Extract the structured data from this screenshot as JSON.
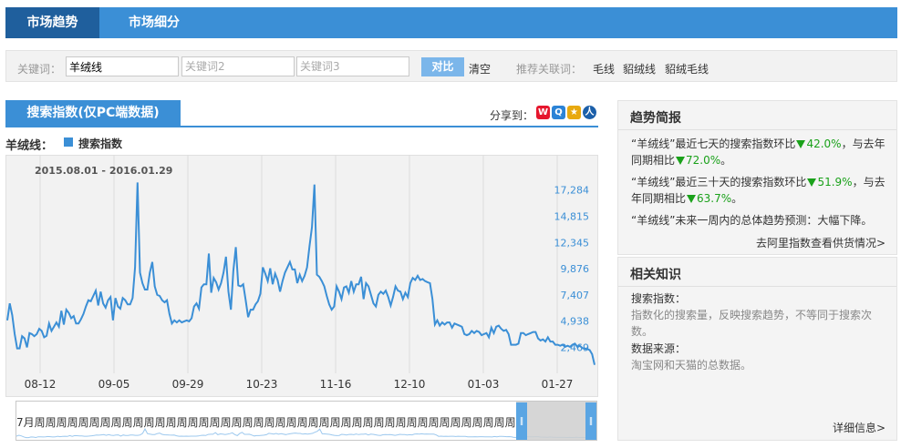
{
  "nav": {
    "tabs": [
      "市场趋势",
      "市场细分"
    ]
  },
  "keywords": {
    "label": "关键词：",
    "kw1_value": "羊绒线",
    "kw2_placeholder": "关键词2",
    "kw3_placeholder": "关键词3",
    "compare_label": "对比",
    "clear_label": "清空",
    "recommend_label": "推荐关联词：",
    "recommend": [
      "毛线",
      "貂绒线",
      "貂绒毛线"
    ]
  },
  "section": {
    "tab_label": "搜索指数(仅PC端数据)",
    "share_label": "分享到：",
    "share_icons": [
      "weibo-icon",
      "qzone-icon",
      "tencent-weibo-icon",
      "renren-icon"
    ]
  },
  "chart_head": {
    "keyword": "羊绒线：",
    "legend": "搜索指数"
  },
  "chart_data": {
    "type": "line",
    "title": "",
    "date_range": "2015.08.01 - 2016.01.29",
    "x_ticks": [
      "08-12",
      "09-05",
      "09-29",
      "10-23",
      "11-16",
      "12-10",
      "01-03",
      "01-27"
    ],
    "y_ticks": [
      2469,
      4938,
      7407,
      9876,
      12345,
      14815,
      17284
    ],
    "y_tick_labels": [
      "2,469",
      "4,938",
      "7,407",
      "9,876",
      "12,345",
      "14,815",
      "17,284"
    ],
    "ylim": [
      0,
      19753
    ],
    "grid": "vertical",
    "series": [
      {
        "name": "搜索指数",
        "color": "#3b8fd6",
        "values": [
          5000,
          6600,
          5500,
          3700,
          2350,
          2350,
          3500,
          3300,
          2450,
          3800,
          3700,
          3500,
          3700,
          4200,
          4000,
          3400,
          3550,
          4700,
          4000,
          4400,
          4800,
          4400,
          5900,
          4600,
          6000,
          5700,
          5200,
          5400,
          4700,
          4700,
          5100,
          5600,
          6300,
          6900,
          6800,
          7300,
          7800,
          6400,
          7700,
          6600,
          6200,
          6900,
          7200,
          5000,
          7100,
          6300,
          6100,
          7100,
          6900,
          6500,
          6500,
          7100,
          10000,
          18000,
          9500,
          8500,
          7900,
          7900,
          9500,
          10500,
          8200,
          7400,
          7300,
          6900,
          6700,
          6900,
          5600,
          4700,
          5000,
          4800,
          5000,
          4800,
          4900,
          5000,
          4900,
          5200,
          6300,
          6600,
          6100,
          8100,
          8400,
          8400,
          11300,
          7600,
          9000,
          8600,
          7900,
          8500,
          9500,
          11000,
          7700,
          6000,
          9700,
          11900,
          8300,
          8200,
          8400,
          6900,
          5300,
          6000,
          6000,
          6500,
          6800,
          7500,
          10000,
          9400,
          8700,
          9900,
          8400,
          9400,
          8800,
          7700,
          8700,
          9500,
          10000,
          10500,
          9800,
          9800,
          8500,
          9300,
          8700,
          9200,
          10000,
          12000,
          13800,
          17800,
          9300,
          9100,
          8700,
          8200,
          7300,
          6500,
          6000,
          6300,
          8200,
          7700,
          7000,
          8100,
          8200,
          7600,
          8700,
          7700,
          8400,
          8400,
          9100,
          7000,
          8500,
          8200,
          7400,
          6600,
          6300,
          7400,
          7700,
          7500,
          7800,
          7200,
          6400,
          7200,
          8200,
          7800,
          7700,
          7000,
          7600,
          7200,
          8500,
          9000,
          8800,
          9200,
          8800,
          8900,
          8700,
          8600,
          8500,
          7000,
          4600,
          5000,
          4500,
          4800,
          4600,
          4800,
          4800,
          4300,
          4700,
          4600,
          4500,
          4400,
          3700,
          3600,
          3700,
          4000,
          3800,
          4000,
          3900,
          3600,
          3700,
          3800,
          3400,
          4300,
          3800,
          4400,
          4500,
          4200,
          4000,
          4100,
          3700,
          2700,
          2700,
          2700,
          2800,
          3800,
          3800,
          3600,
          3700,
          3800,
          3900,
          3900,
          3300,
          3100,
          3200,
          3000,
          3400,
          3000,
          3000,
          2700,
          2700,
          2600,
          2700,
          2500,
          2600,
          2500,
          2700,
          2800,
          2500,
          2600,
          2400,
          2300,
          2300,
          2200,
          1800,
          800
        ]
      }
    ]
  },
  "range_slider": {
    "tick_text": "7月周周周周周周周周周周周周周周周周周周周周周周周周周周周周周周周周周周周周周周周周周周周周周周周周周周周周周周周周周周周周"
  },
  "trend_panel": {
    "title": "趋势简报",
    "line1_pre": "“羊绒线”最近七天的搜索指数环比",
    "line1_v1": "42.0%",
    "line1_mid": "，与去年同期相比",
    "line1_v2": "72.0%",
    "line2_pre": "“羊绒线”最近三十天的搜索指数环比",
    "line2_v1": "51.9%",
    "line2_mid": "，与去年同期相比",
    "line2_v2": "63.7%",
    "line3": "“羊绒线”未来一周内的总体趋势预测：大幅下降。",
    "link": "去阿里指数查看供货情况>"
  },
  "knowledge_panel": {
    "title": "相关知识",
    "q1": "搜索指数：",
    "a1": "指数化的搜索量，反映搜索趋势，不等同于搜索次数。",
    "q2": "数据来源：",
    "a2": "淘宝网和天猫的总数据。",
    "link": "详细信息>"
  }
}
